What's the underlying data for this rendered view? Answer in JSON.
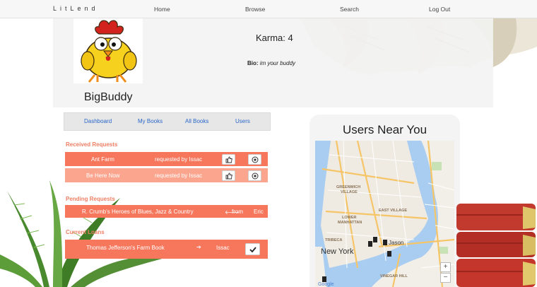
{
  "nav": {
    "brand": "LitLend",
    "links": [
      "Home",
      "Browse",
      "Search",
      "Log Out"
    ]
  },
  "profile": {
    "username": "BigBuddy",
    "karma": "Karma: 4",
    "bio_label": "Bio:",
    "bio_text": "im your buddy"
  },
  "tabs": [
    "Dashboard",
    "My Books",
    "All Books",
    "Users"
  ],
  "received": {
    "heading": "Received Requests",
    "rows": [
      {
        "title": "Ant Farm",
        "status": "requested by Issac"
      },
      {
        "title": "Be Here Now",
        "status": "requested by Issac"
      }
    ]
  },
  "pending": {
    "heading": "Pending Requests",
    "rows": [
      {
        "title": "R. Crumb's Heroes of Blues, Jazz & Country",
        "arrow": "🡐",
        "from_label": "from",
        "user": "Eric"
      }
    ]
  },
  "loans": {
    "heading": "Current Loans",
    "rows": [
      {
        "title": "Thomas Jefferson's Farm Book",
        "arrow": "➔",
        "user": "Issac"
      }
    ]
  },
  "map_panel": {
    "title": "Users Near You",
    "labels": {
      "greenwich": "GREENWICH\nVILLAGE",
      "east_village": "EAST VILLAGE",
      "lower_manhattan": "LOWER\nMANHATTAN",
      "tribeca": "TRIBECA",
      "new_york": "New York",
      "jason": "Jason",
      "vinegar_hill": "VINEGAR HILL",
      "google": "Google"
    },
    "zoom_in": "+",
    "zoom_out": "−"
  },
  "colors": {
    "row_primary": "#f7775d",
    "row_secondary": "#fba58f",
    "heading": "#ef7e63",
    "link": "#2a66c8"
  }
}
